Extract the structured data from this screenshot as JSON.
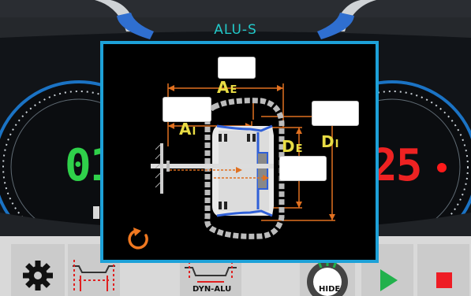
{
  "screen": {
    "title": "ALU-S"
  },
  "readouts": {
    "left": "01",
    "right": "25"
  },
  "dialog": {
    "labels": {
      "ae": "A",
      "ae_sub": "E",
      "ai": "A",
      "ai_sub": "I",
      "de": "D",
      "de_sub": "E",
      "di": "D",
      "di_sub": "I"
    },
    "inputs": {
      "ae": "",
      "ai": "",
      "de": "",
      "di": ""
    },
    "reset_icon": "reset-arrow-icon"
  },
  "toolbar": {
    "dyn_alu_label": "DYN-ALU",
    "hide_label": "HIDE",
    "icons": [
      "gear-icon",
      "rim-profile-icon",
      "dyn-alu-icon",
      "hide-icon",
      "play-icon",
      "stop-icon"
    ]
  },
  "colors": {
    "accent": "#1da1d8",
    "title": "#22c9c9",
    "label": "#e8dc44",
    "dimension_line": "#e07020",
    "left_readout": "#2fd14a",
    "right_readout": "#ee2222",
    "play": "#22b14c",
    "stop": "#ee1c24"
  }
}
